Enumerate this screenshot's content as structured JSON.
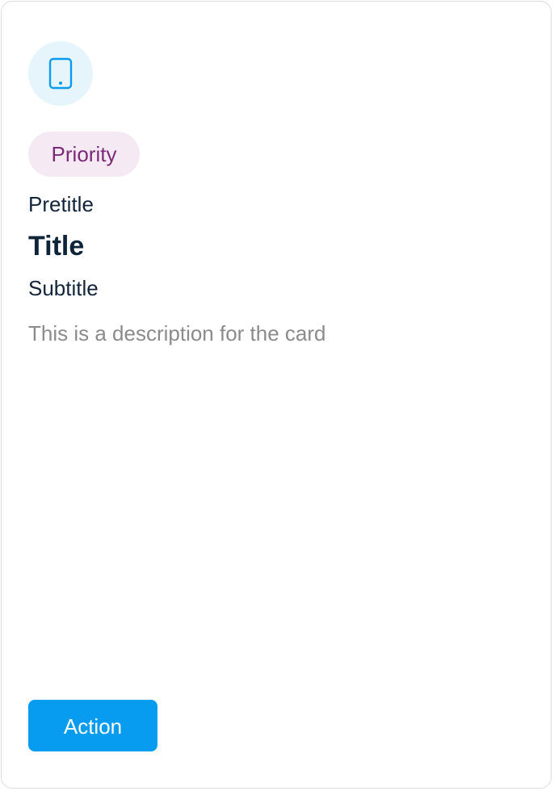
{
  "card": {
    "icon": "smartphone-icon",
    "icon_color": "#079cf0",
    "icon_bg": "#e6f4fc",
    "tag_label": "Priority",
    "tag_color": "#7b2a78",
    "tag_bg": "#f5eaf4",
    "pretitle": "Pretitle",
    "title": "Title",
    "subtitle": "Subtitle",
    "description": "This is a description for the card",
    "action_label": "Action",
    "action_color": "#079cf0"
  }
}
